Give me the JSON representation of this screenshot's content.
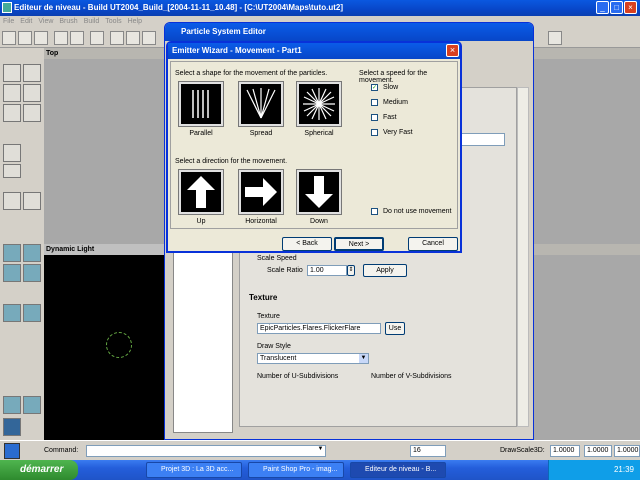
{
  "app": {
    "title": "Editeur de niveau - Build UT2004_Build_[2004-11-11_10.48] - [C:\\UT2004\\Maps\\tuto.ut2]",
    "menu": [
      "File",
      "Edit",
      "View",
      "Brush",
      "Build",
      "Tools",
      "Help"
    ]
  },
  "viewports": {
    "top": "Top",
    "dynamic": "Dynamic Light"
  },
  "pse": {
    "title": "Particle System Editor",
    "scale_speed": "Scale Speed",
    "scale_ratio_label": "Scale Ratio",
    "scale_ratio_value": "1.00",
    "apply": "Apply",
    "texture_header": "Texture",
    "texture_label": "Texture",
    "texture_value": "EpicParticles.Flares.FlickerFlare",
    "use": "Use",
    "draw_style_label": "Draw Style",
    "draw_style_value": "Translucent",
    "u_sub": "Number of U-Subdivisions",
    "v_sub": "Number of V-Subdivisions"
  },
  "wizard": {
    "title": "Emitter Wizard - Movement - Part1",
    "shape_prompt": "Select a shape for the movement of the particles.",
    "shapes": [
      "Parallel",
      "Spread",
      "Spherical"
    ],
    "speed_prompt": "Select a speed for the movement.",
    "speeds": [
      {
        "label": "Slow",
        "checked": true
      },
      {
        "label": "Medium",
        "checked": false
      },
      {
        "label": "Fast",
        "checked": false
      },
      {
        "label": "Very Fast",
        "checked": false
      }
    ],
    "direction_prompt": "Select a direction for the movement.",
    "directions": [
      "Up",
      "Horizontal",
      "Down"
    ],
    "no_movement": "Do not use movement",
    "back": "< Back",
    "next": "Next >",
    "cancel": "Cancel"
  },
  "cmd": {
    "label": "Command:",
    "grid": "16",
    "draw_scale": "DrawScale3D:",
    "v1": "1.0000",
    "v2": "1.0000",
    "v3": "1.0000"
  },
  "taskbar": {
    "start": "démarrer",
    "tasks": [
      "Projet 3D : La 3D acc...",
      "Paint Shop Pro - imag...",
      "Editeur de niveau - B..."
    ],
    "clock": "21:39"
  }
}
